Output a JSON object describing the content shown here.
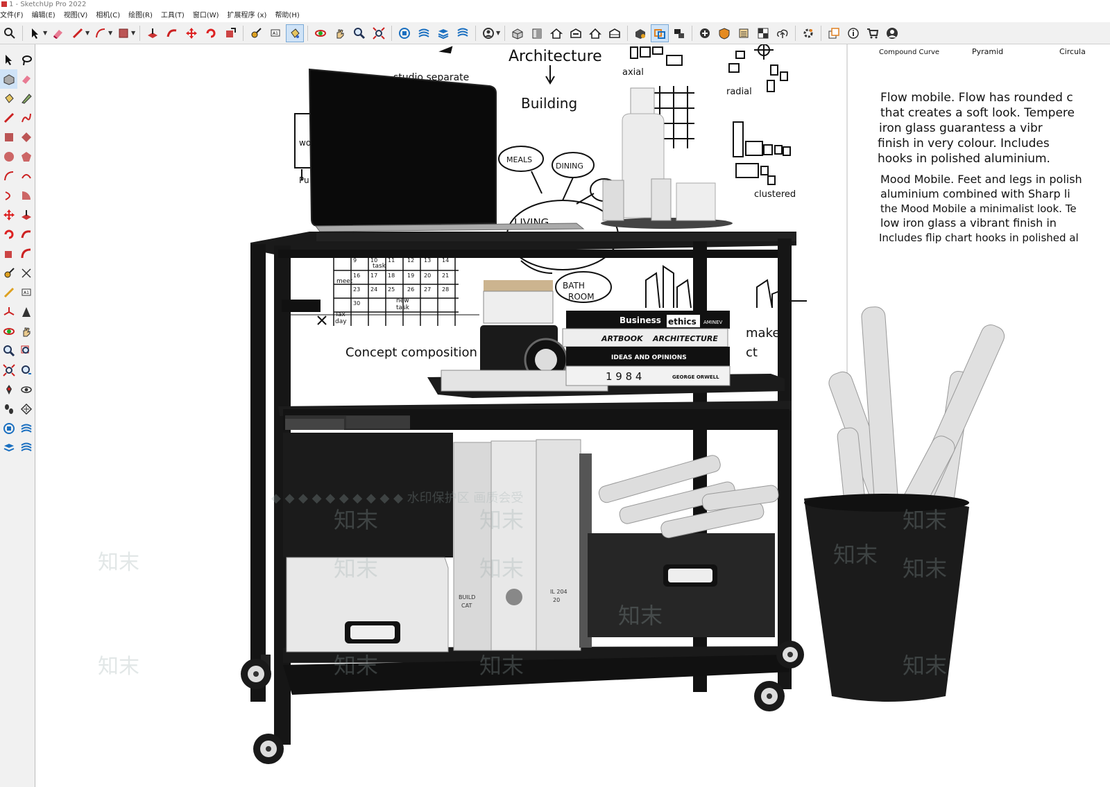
{
  "window": {
    "title": "1 - SketchUp Pro 2022"
  },
  "menu": [
    "文件(F)",
    "编辑(E)",
    "视图(V)",
    "相机(C)",
    "绘图(R)",
    "工具(T)",
    "窗口(W)",
    "扩展程序 (x)",
    "帮助(H)"
  ],
  "toolbar_icons": [
    "search-icon",
    "select-icon",
    "eraser-icon",
    "pencil-icon",
    "arc-icon",
    "rectangle-icon",
    "push-pull-icon",
    "follow-me-icon",
    "move-icon",
    "rotate-icon",
    "scale-icon",
    "tape-measure-icon",
    "text-icon",
    "paint-bucket-icon",
    "orbit-icon",
    "pan-icon",
    "zoom-icon",
    "zoom-extents-icon",
    "warehouse-icon",
    "extension-icon",
    "layers-icon",
    "styles-icon",
    "account-icon",
    "iso-view-icon",
    "front-view-icon",
    "house-icon",
    "top-view-icon",
    "home-icon",
    "section-icon",
    "solid-tools-icon",
    "section-plane-icon",
    "scenes-icon",
    "add-location-icon",
    "shadow-icon",
    "fog-icon",
    "photo-match-icon",
    "upload-icon",
    "settings-icon",
    "outliner-icon",
    "info-icon",
    "cart-icon",
    "profile-icon"
  ],
  "scene": {
    "board_left": {
      "heading": "Architecture",
      "sub": "Building",
      "axial": "axial",
      "radial": "radial",
      "clustered": "clustered",
      "meals": "MEALS",
      "dining": "DINING",
      "living": "LIVING",
      "bath": "BATH",
      "room": "ROOM",
      "concept": "Concept composition",
      "makes": "makes",
      "ct": "ct",
      "studio_note": "studio separate",
      "wo": "wo",
      "pu": "Pu",
      "task": "task",
      "meet": "meet",
      "new_task": "new",
      "task2": "task",
      "tax": "Tax",
      "day": "day",
      "cal_numbers": [
        "9",
        "10",
        "11",
        "12",
        "13",
        "14",
        "16",
        "17",
        "18",
        "19",
        "20",
        "21",
        "23",
        "24",
        "25",
        "26",
        "27",
        "28",
        "30"
      ]
    },
    "board_right": {
      "compound_curve": "Compound Curve",
      "pyramid": "Pyramid",
      "circular": "Circula",
      "para1": [
        "Flow mobile. Flow has rounded c",
        "that creates a soft look. Tempere",
        "iron glass guarantess a vibr",
        "finish in very colour. Includes",
        "hooks in polished aluminium."
      ],
      "para2": [
        "Mood Mobile. Feet and legs in polish",
        "aluminium combined with Sharp li",
        "the Mood Mobile a minimalist look. Te",
        "low iron glass a vibrant finish in",
        "Includes flip chart hooks in polished al"
      ]
    },
    "books": {
      "book1_a": "Business",
      "book1_b": "ethics",
      "book1_c": "AMINEV",
      "book2_a": "ARTBOOK",
      "book2_b": "ARCHITECTURE",
      "book3": "IDEAS AND OPINIONS",
      "book4_a": "1 9 8 4",
      "book4_b": "GEORGE ORWELL"
    },
    "binder_labels": [
      "BUILD",
      "CAT",
      "IL 204",
      "20"
    ],
    "watermark": {
      "banner": "◆ ◆ ◆ ◆ ◆ ◆ ◆ ◆ ◆ ◆  水印保护区  画质会受  ",
      "text": "知末"
    }
  }
}
